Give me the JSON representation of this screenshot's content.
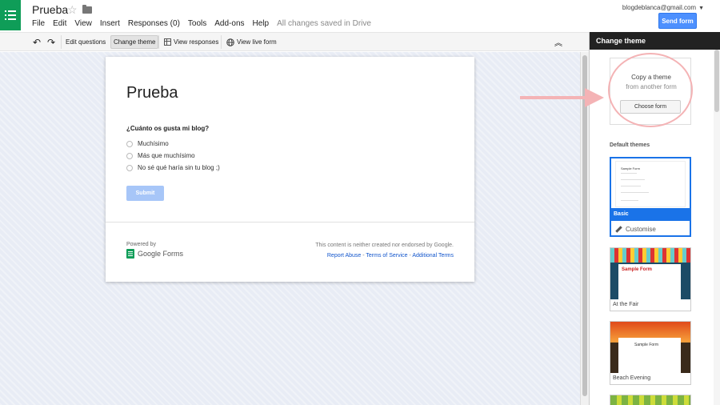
{
  "app": {
    "title": "Prueba",
    "menu": [
      "File",
      "Edit",
      "View",
      "Insert",
      "Responses (0)",
      "Tools",
      "Add-ons",
      "Help"
    ],
    "save_status": "All changes saved in Drive",
    "account": "blogdeblanca@gmail.com",
    "send_label": "Send form"
  },
  "toolbar": {
    "edit_questions": "Edit questions",
    "change_theme": "Change theme",
    "view_responses": "View responses",
    "view_live_form": "View live form"
  },
  "form": {
    "title": "Prueba",
    "question": "¿Cuánto os gusta mi blog?",
    "options": [
      "Muchísimo",
      "Más que muchísimo",
      "No sé qué haría sin tu blog ;)"
    ],
    "submit_label": "Submit",
    "powered_by": "Powered by",
    "brand": "Google Forms",
    "disclaimer": "This content is neither created nor endorsed by Google.",
    "links": [
      "Report Abuse",
      "Terms of Service",
      "Additional Terms"
    ]
  },
  "panel": {
    "title": "Change theme",
    "copy_title": "Copy a theme",
    "copy_subtitle": "from another form",
    "choose_label": "Choose form",
    "default_label": "Default themes",
    "themes": [
      {
        "name": "Basic",
        "action": "Customise"
      },
      {
        "name": "At the Fair"
      },
      {
        "name": "Beach Evening"
      }
    ],
    "preview_text": "Sample Form"
  },
  "colors": {
    "brand_green": "#0f9d58",
    "send_blue": "#4d90fe",
    "highlight": "#f4b3b5",
    "selected_theme": "#1a73e8"
  }
}
